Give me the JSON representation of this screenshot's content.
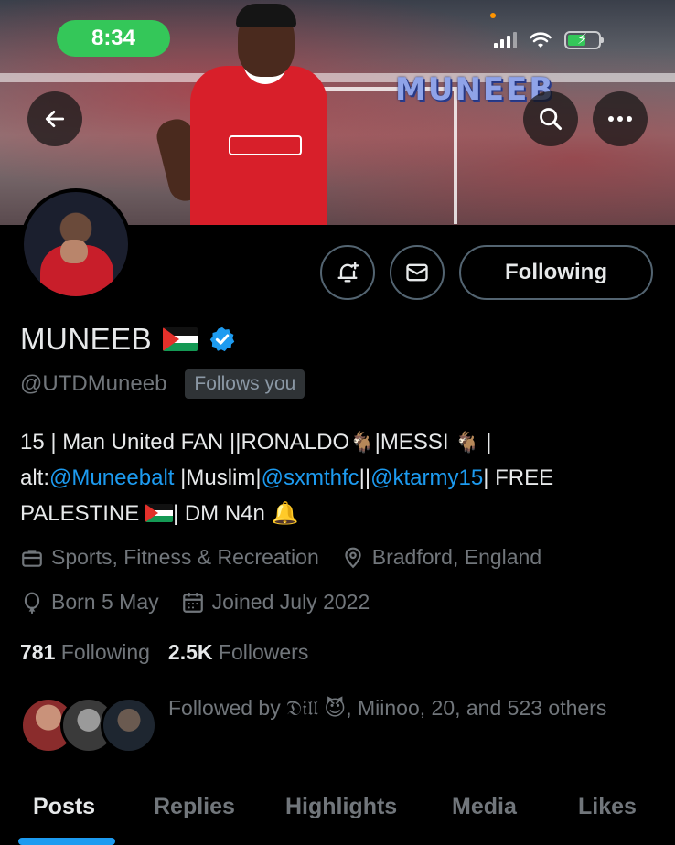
{
  "status_bar": {
    "time": "8:34"
  },
  "banner": {
    "watermark": "MUNEEB"
  },
  "actions": {
    "follow_label": "Following"
  },
  "profile": {
    "display_name": "MUNEEB",
    "handle": "@UTDMuneeb",
    "follows_you": "Follows you",
    "bio": {
      "line1": "15 | Man United FAN ||RONALDO",
      "line1b": "|MESSI",
      "line1c": " |",
      "line2a": "alt:",
      "link1": "@Muneebalt",
      "line2b": " |Muslim|",
      "link2": "@sxmthfc",
      "line2c": "||",
      "link3": "@ktarmy15",
      "line2d": "| FREE",
      "line3a": "PALESTINE",
      "line3b": "| DM N4n"
    },
    "category": "Sports, Fitness & Recreation",
    "location": "Bradford, England",
    "birthday": "Born 5 May",
    "joined": "Joined July 2022"
  },
  "stats": {
    "following_count": "781",
    "following_label": "Following",
    "followers_count": "2.5K",
    "followers_label": "Followers"
  },
  "followed_by": {
    "text": "Followed by 𝔇𝔦𝔩𝔩 😈, Miinoo, 20, and 523 others"
  },
  "tabs": [
    "Posts",
    "Replies",
    "Highlights",
    "Media",
    "Likes"
  ],
  "icons": {
    "back": "arrow-left-icon",
    "search": "search-icon",
    "more": "more-icon",
    "notify": "bell-plus-icon",
    "message": "envelope-icon",
    "verified": "verified-badge-icon",
    "category": "briefcase-icon",
    "location": "location-pin-icon",
    "birthday": "balloon-icon",
    "joined": "calendar-icon"
  },
  "colors": {
    "background": "#000000",
    "accent": "#1d9bf0",
    "muted": "#71767b",
    "time_pill": "#34c759"
  }
}
